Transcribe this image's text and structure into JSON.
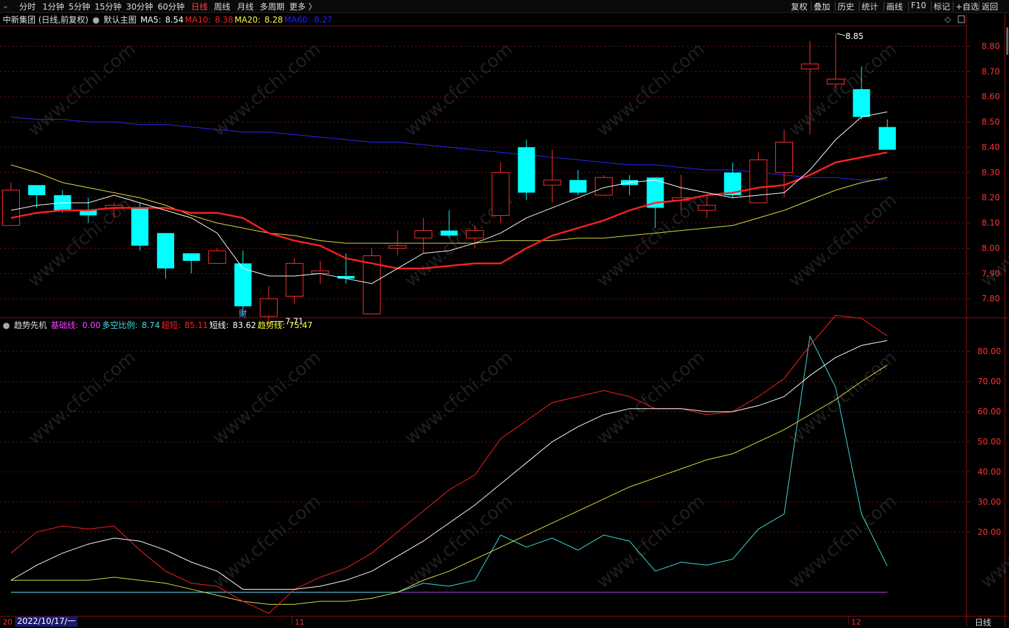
{
  "toolbar": {
    "left": [
      "分时",
      "1分钟",
      "5分钟",
      "15分钟",
      "30分钟",
      "60分钟",
      "日线",
      "周线",
      "月线",
      "多周期",
      "更多 〉"
    ],
    "active": "日线",
    "right": [
      "复权",
      "叠加",
      "历史",
      "统计",
      "画线",
      "F10",
      "标记",
      "+自选",
      "返回"
    ]
  },
  "main": {
    "title": "中新集团 (日线,前复权)",
    "indicator": "默认主图",
    "ma": [
      {
        "label": "MA5:",
        "value": "8.54",
        "color": "#ffffff"
      },
      {
        "label": "MA10:",
        "value": "8.38",
        "color": "#ff2020"
      },
      {
        "label": "MA20:",
        "value": "8.28",
        "color": "#ffff40"
      },
      {
        "label": "MA60:",
        "value": "8.27",
        "color": "#2020ff"
      }
    ],
    "high_label": "8.85",
    "low_label": "7.71",
    "event_label": "财"
  },
  "indicator": {
    "name": "趋势先机",
    "fields": [
      {
        "label": "基础线:",
        "value": "0.00",
        "color": "#ff40ff"
      },
      {
        "label": "多空比例:",
        "value": "8.74",
        "color": "#40e0e0"
      },
      {
        "label": "超短:",
        "value": "85.11",
        "color": "#ff2020"
      },
      {
        "label": "短线:",
        "value": "83.62",
        "color": "#ffffff"
      },
      {
        "label": "趋势线:",
        "value": "75.47",
        "color": "#ffff40"
      }
    ]
  },
  "axis": {
    "price_ticks": [
      "8.80",
      "8.70",
      "8.60",
      "8.50",
      "8.40",
      "8.30",
      "8.20",
      "8.10",
      "8.00",
      "7.90",
      "7.80"
    ],
    "ind_ticks": [
      "80.00",
      "70.00",
      "60.00",
      "50.00",
      "40.00",
      "30.00",
      "20.00"
    ],
    "date_label": "2022/10/17/一",
    "x_ticks": [
      "20",
      "11",
      "12"
    ],
    "period": "日线"
  },
  "watermark": "www.cfchi.com",
  "colors": {
    "up": "#ff3030",
    "down": "#00ffff",
    "grid": "#7a1010",
    "axis_text": "#ff3030"
  },
  "chart_data": {
    "type": "candlestick",
    "candles": [
      {
        "o": 8.09,
        "h": 8.26,
        "l": 8.09,
        "c": 8.23
      },
      {
        "o": 8.25,
        "h": 8.25,
        "l": 8.16,
        "c": 8.21
      },
      {
        "o": 8.21,
        "h": 8.23,
        "l": 8.14,
        "c": 8.15
      },
      {
        "o": 8.15,
        "h": 8.2,
        "l": 8.1,
        "c": 8.13
      },
      {
        "o": 8.16,
        "h": 8.18,
        "l": 8.12,
        "c": 8.17
      },
      {
        "o": 8.16,
        "h": 8.18,
        "l": 7.99,
        "c": 8.01
      },
      {
        "o": 8.06,
        "h": 8.06,
        "l": 7.88,
        "c": 7.92
      },
      {
        "o": 7.98,
        "h": 7.98,
        "l": 7.9,
        "c": 7.95
      },
      {
        "o": 7.94,
        "h": 8.0,
        "l": 7.94,
        "c": 7.99
      },
      {
        "o": 7.94,
        "h": 7.99,
        "l": 7.73,
        "c": 7.77
      },
      {
        "o": 7.73,
        "h": 7.85,
        "l": 7.71,
        "c": 7.8
      },
      {
        "o": 7.81,
        "h": 7.96,
        "l": 7.78,
        "c": 7.94
      },
      {
        "o": 7.9,
        "h": 7.95,
        "l": 7.86,
        "c": 7.91
      },
      {
        "o": 7.89,
        "h": 7.98,
        "l": 7.86,
        "c": 7.88
      },
      {
        "o": 7.74,
        "h": 8.0,
        "l": 7.74,
        "c": 7.97
      },
      {
        "o": 8.0,
        "h": 8.07,
        "l": 7.97,
        "c": 8.01
      },
      {
        "o": 8.04,
        "h": 8.12,
        "l": 7.98,
        "c": 8.07
      },
      {
        "o": 8.07,
        "h": 8.15,
        "l": 8.04,
        "c": 8.05
      },
      {
        "o": 8.04,
        "h": 8.09,
        "l": 8.0,
        "c": 8.07
      },
      {
        "o": 8.13,
        "h": 8.34,
        "l": 8.1,
        "c": 8.3
      },
      {
        "o": 8.4,
        "h": 8.43,
        "l": 8.19,
        "c": 8.22
      },
      {
        "o": 8.25,
        "h": 8.39,
        "l": 8.18,
        "c": 8.27
      },
      {
        "o": 8.27,
        "h": 8.31,
        "l": 8.21,
        "c": 8.22
      },
      {
        "o": 8.21,
        "h": 8.29,
        "l": 8.21,
        "c": 8.28
      },
      {
        "o": 8.27,
        "h": 8.29,
        "l": 8.21,
        "c": 8.25
      },
      {
        "o": 8.28,
        "h": 8.28,
        "l": 8.08,
        "c": 8.16
      },
      {
        "o": 8.19,
        "h": 8.29,
        "l": 8.15,
        "c": 8.2
      },
      {
        "o": 8.15,
        "h": 8.21,
        "l": 8.12,
        "c": 8.17
      },
      {
        "o": 8.3,
        "h": 8.34,
        "l": 8.2,
        "c": 8.21
      },
      {
        "o": 8.18,
        "h": 8.38,
        "l": 8.18,
        "c": 8.35
      },
      {
        "o": 8.3,
        "h": 8.47,
        "l": 8.2,
        "c": 8.42
      },
      {
        "o": 8.71,
        "h": 8.82,
        "l": 8.45,
        "c": 8.73
      },
      {
        "o": 8.65,
        "h": 8.85,
        "l": 8.63,
        "c": 8.67
      },
      {
        "o": 8.63,
        "h": 8.72,
        "l": 8.51,
        "c": 8.52
      },
      {
        "o": 8.48,
        "h": 8.51,
        "l": 8.39,
        "c": 8.39
      }
    ],
    "ma5": [
      8.15,
      8.17,
      8.18,
      8.18,
      8.21,
      8.18,
      8.15,
      8.12,
      8.06,
      7.92,
      7.89,
      7.89,
      7.9,
      7.88,
      7.86,
      7.92,
      7.98,
      7.99,
      8.02,
      8.06,
      8.12,
      8.16,
      8.2,
      8.24,
      8.26,
      8.27,
      8.24,
      8.22,
      8.2,
      8.21,
      8.22,
      8.31,
      8.43,
      8.52,
      8.54
    ],
    "ma10": [
      8.12,
      8.14,
      8.15,
      8.15,
      8.16,
      8.16,
      8.16,
      8.14,
      8.14,
      8.12,
      8.06,
      8.03,
      8.01,
      7.96,
      7.94,
      7.92,
      7.92,
      7.93,
      7.94,
      7.94,
      8.0,
      8.05,
      8.08,
      8.11,
      8.15,
      8.18,
      8.19,
      8.21,
      8.22,
      8.24,
      8.25,
      8.29,
      8.34,
      8.36,
      8.38
    ],
    "ma20": [
      8.33,
      8.3,
      8.26,
      8.24,
      8.22,
      8.2,
      8.17,
      8.13,
      8.1,
      8.08,
      8.06,
      8.05,
      8.03,
      8.02,
      8.02,
      8.02,
      8.02,
      8.02,
      8.02,
      8.03,
      8.03,
      8.03,
      8.04,
      8.04,
      8.05,
      8.06,
      8.07,
      8.08,
      8.09,
      8.12,
      8.15,
      8.19,
      8.23,
      8.26,
      8.28
    ],
    "ma60": [
      8.52,
      8.51,
      8.51,
      8.5,
      8.5,
      8.49,
      8.49,
      8.48,
      8.47,
      8.46,
      8.46,
      8.45,
      8.44,
      8.43,
      8.42,
      8.42,
      8.41,
      8.4,
      8.39,
      8.38,
      8.37,
      8.36,
      8.35,
      8.34,
      8.33,
      8.33,
      8.32,
      8.31,
      8.31,
      8.3,
      8.29,
      8.28,
      8.28,
      8.27,
      8.27
    ],
    "ind_basic": [
      0,
      0,
      0,
      0,
      0,
      0,
      0,
      0,
      0,
      0,
      0,
      0,
      0,
      0,
      0,
      0,
      0,
      0,
      0,
      0,
      0,
      0,
      0,
      0,
      0,
      0,
      0,
      0,
      0,
      0,
      0,
      0,
      0,
      0,
      0
    ],
    "ind_ratio": [
      0,
      0,
      0,
      0,
      0,
      0,
      0,
      0,
      0,
      0,
      0,
      0,
      0,
      0,
      0,
      0,
      3,
      2,
      4,
      19,
      15,
      18,
      14,
      19,
      17,
      7,
      10,
      9,
      11,
      21,
      26,
      85,
      68,
      26,
      8.74
    ],
    "ind_ultra": [
      13,
      20,
      22,
      21,
      22,
      14,
      7,
      3,
      2,
      -3,
      -7,
      1,
      5,
      8,
      13,
      20,
      27,
      34,
      39,
      51,
      57,
      63,
      65,
      67,
      65,
      61,
      61,
      59,
      60,
      65,
      71,
      82,
      92,
      91,
      85.11
    ],
    "ind_short": [
      4,
      9,
      13,
      16,
      18,
      17,
      14,
      10,
      7,
      1,
      1,
      1,
      2,
      4,
      7,
      12,
      17,
      23,
      29,
      36,
      43,
      50,
      55,
      59,
      61,
      61,
      61,
      60,
      60,
      62,
      65,
      72,
      78,
      82,
      83.62
    ],
    "ind_trend": [
      4,
      4,
      4,
      4,
      5,
      4,
      3,
      1,
      -1,
      -3,
      -4,
      -4,
      -3,
      -3,
      -2,
      0,
      4,
      7,
      11,
      15,
      19,
      23,
      27,
      31,
      35,
      38,
      41,
      44,
      46,
      50,
      54,
      59,
      64,
      70,
      75.47
    ]
  }
}
